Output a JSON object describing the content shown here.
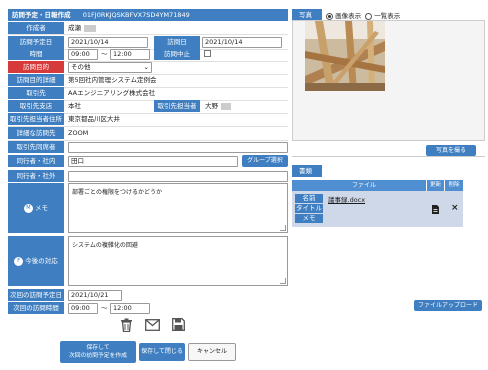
{
  "header": {
    "title": "訪問予定・日報作成",
    "id": "01FJ0RKJQSKBFVX7SD4YM71849"
  },
  "rows": {
    "author": {
      "label": "作成者",
      "value": "成瀬"
    },
    "planned_date": {
      "label": "訪問予定日",
      "value": "2021/10/14"
    },
    "visit_date": {
      "label": "訪問日",
      "value": "2021/10/14"
    },
    "time": {
      "label": "時間",
      "start": "09:00",
      "tilde": "～",
      "end": "12:00"
    },
    "cancel": {
      "label": "訪問中止"
    },
    "purpose": {
      "label": "訪問目的",
      "value": "その他"
    },
    "purpose_detail": {
      "label": "訪問目的詳細",
      "value": "第5回社内管理システム定例会"
    },
    "client": {
      "label": "取引先",
      "value": "AAエンジニアリング株式会社"
    },
    "branch": {
      "label": "取引先支店",
      "value": "本社"
    },
    "contact": {
      "label": "取引先担当者",
      "value": "大野"
    },
    "address": {
      "label": "取引先担当者住所",
      "value": "東京都品川区大井"
    },
    "place": {
      "label": "詳細な訪問先",
      "value": "ZOOM"
    },
    "attendee": {
      "label": "取引先同席者",
      "value": ""
    },
    "internal": {
      "label": "同行者・社内",
      "value": "田口",
      "button": "グループ選択"
    },
    "external": {
      "label": "同行者・社外",
      "value": ""
    },
    "memo": {
      "label": "メモ",
      "icon_letter": "M",
      "value": "部署ごとの権限をつけるかどうか"
    },
    "next_action": {
      "label": "今後の対応",
      "icon_letter": "F",
      "value": "システムの複雑化の回避"
    },
    "next_date": {
      "label": "次回の訪問予定日",
      "value": "2021/10/21"
    },
    "next_time": {
      "label": "次回の訪問時間",
      "start": "09:00",
      "tilde": "～",
      "end": "12:00"
    }
  },
  "actions": {
    "save_next": "保存して\n次回の訪問予定を作成",
    "save_close": "保存して閉じる",
    "cancel": "キャンセル"
  },
  "photo": {
    "label": "写真",
    "radio_image": "画像表示",
    "radio_list": "一覧表示",
    "take_button": "写真を撮る"
  },
  "documents": {
    "label": "書類",
    "col_file": "ファイル",
    "col_update": "更新",
    "col_delete": "削除",
    "row": {
      "name_label": "名前",
      "title_label": "タイトル",
      "memo_label": "メモ",
      "file_name": "議事録.docx"
    },
    "upload_button": "ファイルアップロード"
  },
  "colors": {
    "accent": "#3f7fc1",
    "required": "#d63a3a",
    "table_header": "#4f8ed0",
    "row_bg": "#cfd8e8"
  },
  "icons": [
    "trash-icon",
    "mail-icon",
    "save-icon",
    "document-icon",
    "close-icon"
  ]
}
